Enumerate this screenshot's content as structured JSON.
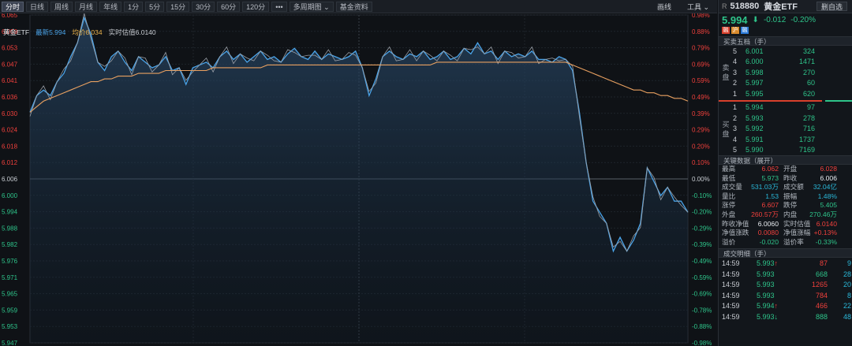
{
  "toolbar": {
    "tabs": [
      "分时",
      "日线",
      "周线",
      "月线",
      "年线",
      "1分",
      "5分",
      "15分",
      "30分",
      "60分",
      "120分",
      "•••",
      "多周期图 ⌄",
      "基金资料"
    ],
    "right": [
      "画线",
      "工具 ⌄"
    ]
  },
  "legend": {
    "name": "黄金ETF",
    "latest": "最新5.994",
    "avg": "均价6.034",
    "est": "实时估值6.0140"
  },
  "axes": {
    "left": [
      "6.065",
      "6.059",
      "6.053",
      "6.047",
      "6.041",
      "6.036",
      "6.030",
      "6.024",
      "6.018",
      "6.012",
      "6.006",
      "6.000",
      "5.994",
      "5.988",
      "5.982",
      "5.976",
      "5.971",
      "5.965",
      "5.959",
      "5.953",
      "5.947"
    ],
    "right": [
      "0.98%",
      "0.88%",
      "0.79%",
      "0.69%",
      "0.59%",
      "0.49%",
      "0.39%",
      "0.29%",
      "0.20%",
      "0.10%",
      "0.00%",
      "-0.10%",
      "-0.20%",
      "-0.29%",
      "-0.39%",
      "-0.49%",
      "-0.59%",
      "-0.69%",
      "-0.78%",
      "-0.88%",
      "-0.98%"
    ]
  },
  "chart_data": {
    "type": "line",
    "ylim": [
      5.947,
      6.065
    ],
    "prev_close": 6.006,
    "series": [
      {
        "values": [
          6.03,
          6.036,
          6.038,
          6.036,
          6.041,
          6.044,
          6.05,
          6.055,
          6.064,
          6.058,
          6.048,
          6.045,
          6.05,
          6.052,
          6.048,
          6.045,
          6.05,
          6.048,
          6.046,
          6.047,
          6.05,
          6.045,
          6.046,
          6.04,
          6.046,
          6.047,
          6.048,
          6.046,
          6.05,
          6.052,
          6.049,
          6.051,
          6.048,
          6.05,
          6.052,
          6.049,
          6.05,
          6.048,
          6.051,
          6.053,
          6.05,
          6.049,
          6.052,
          6.049,
          6.051,
          6.05,
          6.049,
          6.05,
          6.052,
          6.046,
          6.036,
          6.042,
          6.05,
          6.052,
          6.05,
          6.049,
          6.051,
          6.05,
          6.052,
          6.049,
          6.05,
          6.052,
          6.049,
          6.05,
          6.053,
          6.051,
          6.055,
          6.051,
          6.052,
          6.049,
          6.052,
          6.05,
          6.051,
          6.05,
          6.052,
          6.049,
          6.049,
          6.048,
          6.05,
          6.049,
          6.045,
          6.03,
          6.012,
          5.998,
          5.994,
          5.99,
          5.98,
          5.985,
          5.98,
          5.984,
          5.99,
          6.01,
          6.005,
          6.0,
          6.003,
          5.998,
          5.998,
          5.994
        ]
      },
      {
        "values": [
          6.03,
          6.032,
          6.034,
          6.035,
          6.036,
          6.037,
          6.038,
          6.039,
          6.04,
          6.041,
          6.041,
          6.042,
          6.042,
          6.043,
          6.043,
          6.043,
          6.044,
          6.044,
          6.044,
          6.044,
          6.045,
          6.045,
          6.045,
          6.045,
          6.045,
          6.045,
          6.045,
          6.046,
          6.046,
          6.046,
          6.046,
          6.046,
          6.046,
          6.046,
          6.046,
          6.047,
          6.047,
          6.047,
          6.047,
          6.047,
          6.047,
          6.047,
          6.047,
          6.047,
          6.047,
          6.047,
          6.047,
          6.047,
          6.047,
          6.047,
          6.047,
          6.047,
          6.047,
          6.047,
          6.047,
          6.047,
          6.047,
          6.047,
          6.047,
          6.047,
          6.048,
          6.048,
          6.048,
          6.048,
          6.048,
          6.048,
          6.048,
          6.048,
          6.048,
          6.048,
          6.048,
          6.048,
          6.048,
          6.048,
          6.048,
          6.048,
          6.048,
          6.048,
          6.048,
          6.048,
          6.047,
          6.046,
          6.045,
          6.044,
          6.043,
          6.042,
          6.041,
          6.04,
          6.039,
          6.038,
          6.038,
          6.037,
          6.037,
          6.036,
          6.036,
          6.035,
          6.035,
          6.034
        ]
      }
    ]
  },
  "side": {
    "r": "R",
    "code": "518880",
    "name": "黄金ETF",
    "add": "删自选",
    "price": "5.994",
    "change": "-0.012",
    "pct": "-0.20%",
    "badges": [
      "融",
      "沪",
      "融"
    ],
    "ob_title": "买卖五档（手）",
    "sell_label": "卖盘",
    "buy_label": "买盘",
    "asks": [
      {
        "lv": "5",
        "p": "6.001",
        "v": "324"
      },
      {
        "lv": "4",
        "p": "6.000",
        "v": "1471"
      },
      {
        "lv": "3",
        "p": "5.998",
        "v": "270"
      },
      {
        "lv": "2",
        "p": "5.997",
        "v": "60"
      },
      {
        "lv": "1",
        "p": "5.995",
        "v": "620"
      }
    ],
    "bids": [
      {
        "lv": "1",
        "p": "5.994",
        "v": "97"
      },
      {
        "lv": "2",
        "p": "5.993",
        "v": "278"
      },
      {
        "lv": "3",
        "p": "5.992",
        "v": "716"
      },
      {
        "lv": "4",
        "p": "5.991",
        "v": "1737"
      },
      {
        "lv": "5",
        "p": "5.990",
        "v": "7169"
      }
    ],
    "kd_title": "关键数据（展开）",
    "kd": [
      [
        "最高",
        "6.062",
        "red",
        "开盘",
        "6.028",
        "red"
      ],
      [
        "最低",
        "5.973",
        "green",
        "昨收",
        "6.006",
        "white"
      ],
      [
        "成交量",
        "531.03万",
        "cyan",
        "成交额",
        "32.04亿",
        "cyan"
      ],
      [
        "量比",
        "1.53",
        "cyan",
        "振幅",
        "1.48%",
        "cyan"
      ],
      [
        "涨停",
        "6.607",
        "red",
        "跌停",
        "5.405",
        "green"
      ],
      [
        "外盘",
        "260.57万",
        "red",
        "内盘",
        "270.46万",
        "green"
      ],
      [
        "昨收净值",
        "6.0060",
        "white",
        "实时估值",
        "6.0140",
        "red"
      ],
      [
        "净值涨跌",
        "0.0080",
        "red",
        "净值涨幅",
        "+0.13%",
        "red"
      ],
      [
        "溢价",
        "-0.020",
        "green",
        "溢价率",
        "-0.33%",
        "green"
      ]
    ],
    "tk_title": "成交明细（手）",
    "ticks": [
      {
        "t": "14:59",
        "p": "5.993",
        "arrow": "↑",
        "ac": "red",
        "v": "87",
        "vc": "red",
        "n": "9"
      },
      {
        "t": "14:59",
        "p": "5.993",
        "arrow": "",
        "ac": "",
        "v": "668",
        "vc": "green",
        "n": "28"
      },
      {
        "t": "14:59",
        "p": "5.993",
        "arrow": "",
        "ac": "",
        "v": "1265",
        "vc": "red",
        "n": "20"
      },
      {
        "t": "14:59",
        "p": "5.993",
        "arrow": "",
        "ac": "",
        "v": "784",
        "vc": "red",
        "n": "8"
      },
      {
        "t": "14:59",
        "p": "5.994",
        "arrow": "↑",
        "ac": "red",
        "v": "466",
        "vc": "red",
        "n": "22"
      },
      {
        "t": "14:59",
        "p": "5.993",
        "arrow": "↓",
        "ac": "green",
        "v": "888",
        "vc": "green",
        "n": "48"
      }
    ]
  }
}
